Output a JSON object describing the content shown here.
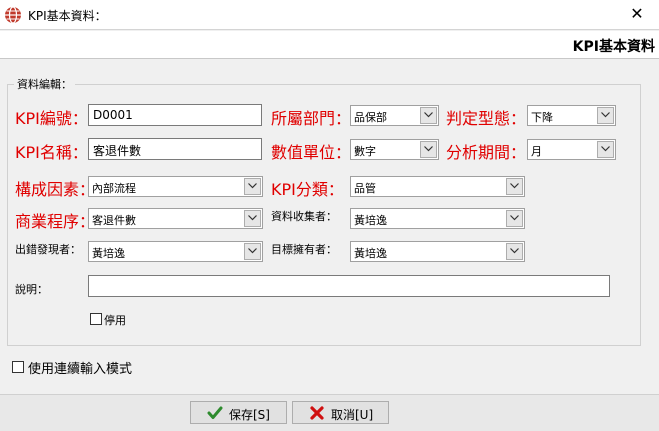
{
  "window": {
    "title": "KPI基本資料：",
    "close_glyph": "✕"
  },
  "header": {
    "title": "KPI基本資料"
  },
  "group": {
    "title": "資料編輯："
  },
  "fields": {
    "kpi_code": {
      "label": "KPI編號：",
      "value": "D0001"
    },
    "kpi_name": {
      "label": "KPI名稱：",
      "value": "客退件數"
    },
    "department": {
      "label": "所屬部門：",
      "value": "品保部"
    },
    "judge_type": {
      "label": "判定型態：",
      "value": "下降"
    },
    "value_unit": {
      "label": "數值單位：",
      "value": "數字"
    },
    "analysis_period": {
      "label": "分析期間：",
      "value": "月"
    },
    "factor": {
      "label": "構成因素：",
      "value": "內部流程"
    },
    "kpi_category": {
      "label": "KPI分類：",
      "value": "品管"
    },
    "business_process": {
      "label": "商業程序：",
      "value": "客退件數"
    },
    "data_collector": {
      "label": "資料收集者：",
      "value": "黃培逸"
    },
    "error_finder": {
      "label": "出錯發現者：",
      "value": "黃培逸"
    },
    "target_owner": {
      "label": "目標擁有者：",
      "value": "黃培逸"
    },
    "description": {
      "label": "說明：",
      "value": ""
    }
  },
  "disable_checkbox": {
    "label": "停用",
    "checked": false
  },
  "continuous_mode": {
    "label": "使用連續輸入模式",
    "checked": false
  },
  "buttons": {
    "save": {
      "label": "保存[S]",
      "icon": "check-icon",
      "color": "#2e8b2e"
    },
    "cancel": {
      "label": "取消[U]",
      "icon": "cross-icon",
      "color": "#d01010"
    }
  },
  "colors": {
    "label_red": "#e00000"
  }
}
